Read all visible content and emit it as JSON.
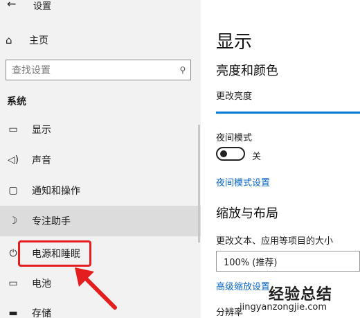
{
  "window": {
    "back_icon": "arrow-left-icon",
    "title": "设置"
  },
  "sidebar": {
    "home": {
      "icon": "home-icon",
      "label": "主页"
    },
    "search": {
      "placeholder": "查找设置",
      "icon": "search-icon"
    },
    "group_label": "系统",
    "items": [
      {
        "icon": "monitor-icon",
        "label": "显示"
      },
      {
        "icon": "speaker-icon",
        "label": "声音"
      },
      {
        "icon": "notification-icon",
        "label": "通知和操作"
      },
      {
        "icon": "moon-icon",
        "label": "专注助手"
      },
      {
        "icon": "power-icon",
        "label": "电源和睡眠"
      },
      {
        "icon": "battery-icon",
        "label": "电池"
      },
      {
        "icon": "storage-icon",
        "label": "存储"
      }
    ]
  },
  "main": {
    "title": "显示",
    "brightness_section": "亮度和颜色",
    "brightness_label": "更改亮度",
    "night_mode_label": "夜间模式",
    "night_mode_state": "关",
    "night_mode_on": false,
    "night_mode_link": "夜间模式设置",
    "scale_section": "缩放与布局",
    "scale_label": "更改文本、应用等项目的大小",
    "scale_value": "100% (推荐)",
    "advanced_scale_link": "高级缩放设置",
    "resolution_label": "分辨率"
  },
  "watermark": {
    "title": "经验总结",
    "url": "jingyanzongjie.com"
  },
  "colors": {
    "accent": "#0078d7",
    "annotation": "#e41e1e",
    "sidebar_bg": "#f2f2f2"
  }
}
